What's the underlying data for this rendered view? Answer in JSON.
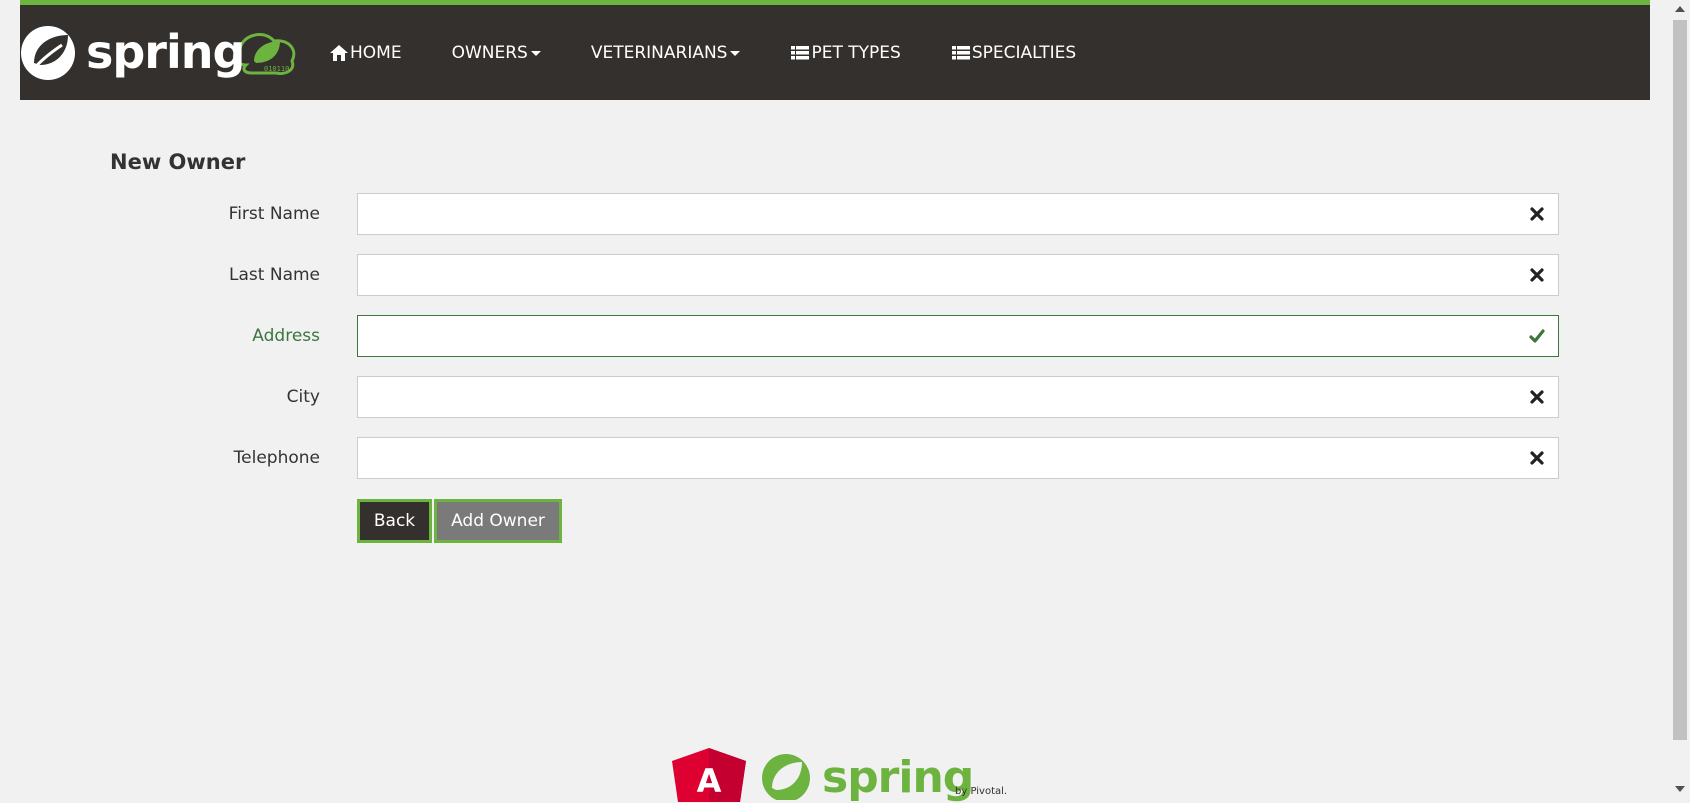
{
  "brand": {
    "logo_text": "spring",
    "logo_badge": "010110"
  },
  "nav": {
    "items": [
      {
        "id": "home",
        "label": "Home",
        "icon": "home-icon",
        "dropdown": false
      },
      {
        "id": "owners",
        "label": "Owners",
        "icon": null,
        "dropdown": true
      },
      {
        "id": "veterinarians",
        "label": "Veterinarians",
        "icon": null,
        "dropdown": true
      },
      {
        "id": "pet-types",
        "label": "Pet Types",
        "icon": "list-icon",
        "dropdown": false
      },
      {
        "id": "specialties",
        "label": "Specialties",
        "icon": "list-icon",
        "dropdown": false
      }
    ]
  },
  "page": {
    "title": "New Owner"
  },
  "form": {
    "fields": [
      {
        "id": "first-name",
        "label": "First Name",
        "value": "",
        "status": "invalid",
        "status_icon": "remove-icon"
      },
      {
        "id": "last-name",
        "label": "Last Name",
        "value": "",
        "status": "invalid",
        "status_icon": "remove-icon"
      },
      {
        "id": "address",
        "label": "Address",
        "value": "",
        "status": "valid",
        "status_icon": "check-icon"
      },
      {
        "id": "city",
        "label": "City",
        "value": "",
        "status": "invalid",
        "status_icon": "remove-icon"
      },
      {
        "id": "telephone",
        "label": "Telephone",
        "value": "",
        "status": "invalid",
        "status_icon": "remove-icon"
      }
    ],
    "back_label": "Back",
    "submit_label": "Add Owner"
  },
  "footer": {
    "spring_text": "spring",
    "angular_letter": "A",
    "pivotal_text": "by Pivotal."
  },
  "colors": {
    "brand_green": "#6db33f",
    "navbar_bg": "#34302d",
    "valid_green": "#3c763d",
    "angular_red": "#dd0031",
    "page_bg": "#f1f1f1"
  }
}
